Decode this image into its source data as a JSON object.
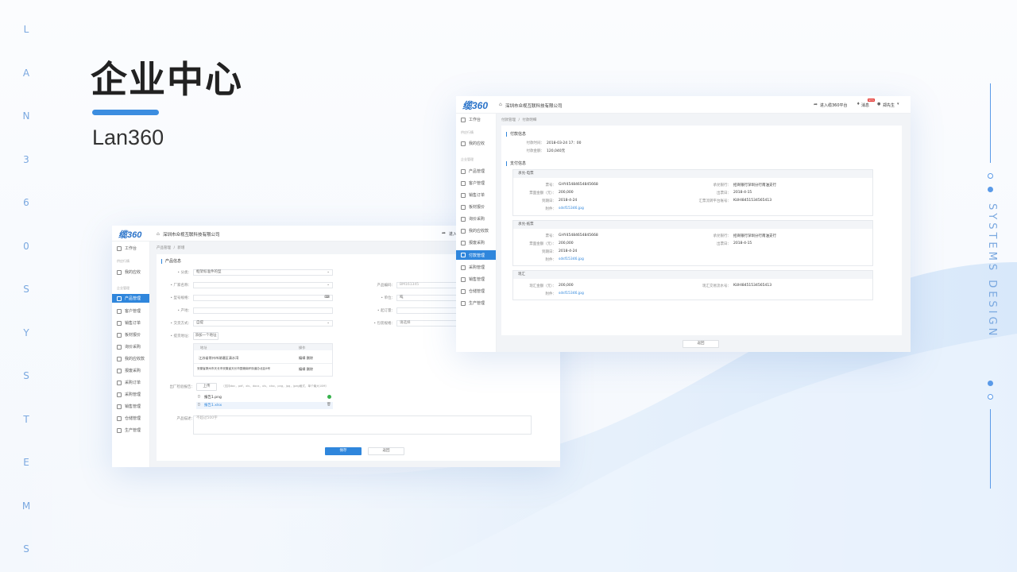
{
  "hero": {
    "title": "企业中心",
    "subtitle": "Lan360",
    "side_letters": [
      "L",
      "A",
      "N",
      "3",
      "6",
      "0",
      "S",
      "Y",
      "S",
      "T",
      "E",
      "M",
      "S"
    ],
    "right_caption": "SYSTEMS DESIGN",
    "accent": "#3c8de0"
  },
  "front": {
    "logo": "缆360",
    "company": "深圳市众视互联科技有限公司",
    "enter_platform": "进入",
    "breadcrumb": [
      "产品管理",
      "/",
      "新增"
    ],
    "sidebar": {
      "workbench": "工作台",
      "group1": "供应行情",
      "group1_items": [
        "我的应收"
      ],
      "group2": "企业管理",
      "group2_items": [
        "产品管理",
        "客户管理",
        "销售订单",
        "板材报价",
        "询价采购",
        "我的应收款",
        "报废采购",
        "采购订单",
        "采购管理",
        "销售管理",
        "仓储管理",
        "生产管理"
      ],
      "active": "产品管理"
    },
    "section": "产品信息",
    "fields": {
      "category_label": "• 分类：",
      "category_value": "框架标准件的型",
      "brand_label": "• 厂家名称：",
      "code_label": "产品编码：",
      "code_value": "BM161345",
      "model_label": "• 型号规格：",
      "unit_label": "• 单位：",
      "unit_value": "吨",
      "origin_label": "• 产地：",
      "price_label": "• 起订量：",
      "ship_label": "• 交货方式：",
      "ship_value": "自提",
      "pack_label": "• 包装规格：",
      "pack_value": "请选择",
      "address_label": "• 提货地址：",
      "address_button": "添加一个地址"
    },
    "address_table": {
      "headers": [
        "地址",
        "操作"
      ],
      "rows": [
        {
          "addr": "江苏省常州市湖塘区清水湾",
          "ops": "编辑  删除"
        },
        {
          "addr": "安徽省滁州市天长市安徽省天长市国储南环街道办北区6号",
          "ops": "编辑  删除"
        }
      ]
    },
    "upload": {
      "label": "出厂检验报告：",
      "button": "上传",
      "hint": "（支持doc，pdf，xls，docx，xls，xlsx，png，jpg，jpeg格式，单个最大10M）",
      "files": [
        "报告1.png",
        "报告1.xlsx"
      ]
    },
    "desc": {
      "label": "产品描述：",
      "placeholder": "不超过500字"
    },
    "buttons": {
      "save": "保存",
      "back": "返回"
    }
  },
  "back": {
    "logo": "缆360",
    "company": "深圳市众视互联科技有限公司",
    "enter_platform": "进入缆360平台",
    "messages": "消息",
    "badge": "NEW",
    "user": "郑先生",
    "breadcrumb": [
      "付款管理",
      "/",
      "付款明细"
    ],
    "sidebar": {
      "workbench": "工作台",
      "group1": "供应行情",
      "group1_items": [
        "我的应收"
      ],
      "group2": "企业管理",
      "group2_items": [
        "产品管理",
        "客户管理",
        "销售订单",
        "板材报价",
        "询价采购",
        "我的应收款",
        "报废采购",
        "付款管理",
        "采购管理",
        "销售管理",
        "仓储管理",
        "生产管理"
      ],
      "active": "付款管理"
    },
    "pay_info": {
      "title": "付款信息",
      "time_label": "付款时间：",
      "time_value": "2018-03-24 17：00",
      "amount_label": "付款金额：",
      "amount_value": "120,040元"
    },
    "method": {
      "title": "支付信息",
      "blocks": [
        {
          "header": "承兑-电票",
          "rows": [
            [
              "票号：",
              "GHY45484654845668",
              "承兑银行：",
              "招商银行深圳分行南油支行"
            ],
            [
              "票面金额（元）：",
              "200,000",
              "出票日：",
              "2018-4-15"
            ],
            [
              "到期日：",
              "2018-4-24",
              "汇票流转平台账号：",
              "KUHI8451534565413"
            ],
            [
              "附件：",
              "sdsf15346.jpg",
              "",
              ""
            ]
          ]
        },
        {
          "header": "承兑-纸票",
          "rows": [
            [
              "票号：",
              "GHY45484654845668",
              "承兑银行：",
              "招商银行深圳分行南油支行"
            ],
            [
              "票面金额（元）：",
              "200,000",
              "出票日：",
              "2018-4-15"
            ],
            [
              "到期日：",
              "2018-4-24",
              "",
              ""
            ],
            [
              "附件：",
              "sdsf15346.jpg",
              "",
              ""
            ]
          ]
        },
        {
          "header": "现汇",
          "rows": [
            [
              "现汇金额（元）：",
              "200,000",
              "现汇交易流水号：",
              "KUHI8451534565413"
            ],
            [
              "附件：",
              "sdsf15346.jpg",
              "",
              ""
            ]
          ]
        }
      ]
    },
    "back_button": "返回"
  }
}
